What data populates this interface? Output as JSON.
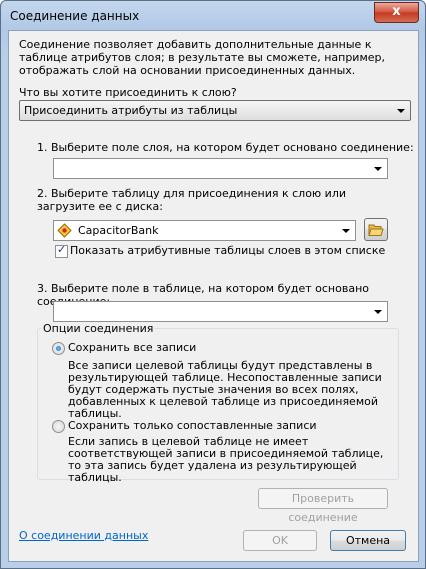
{
  "window": {
    "title": "Соединение данных",
    "close_glyph": "x"
  },
  "description": "Соединение позволяет добавить дополнительные данные к таблице атрибутов слоя; в результате вы сможете, например, отображать слой на основании присоединенных данных.",
  "question": {
    "label": "Что вы хотите присоединить к слою?",
    "value": "Присоединить атрибуты из таблицы"
  },
  "step1": {
    "label": "1.  Выберите поле слоя, на котором будет основано соединение:",
    "value": ""
  },
  "step2": {
    "label": "2.  Выберите таблицу для присоединения к слою или загрузите ее с диска:",
    "value": "CapacitorBank",
    "browse_icon": "open-folder-icon",
    "layer_icon": "table-layer-icon",
    "checkbox_label": "Показать атрибутивные таблицы слоев в этом списке",
    "checkbox_checked": true
  },
  "step3": {
    "label": "3.  Выберите поле в таблице, на котором будет основано соединение:",
    "value": ""
  },
  "options": {
    "legend": "Опции соединения",
    "keep_all": {
      "label": "Сохранить все записи",
      "selected": true,
      "description": "Все записи целевой таблицы будут представлены в результирующей таблице. Несопоставленные записи будут содержать пустые значения во всех полях, добавленных к целевой таблице из присоединяемой таблицы."
    },
    "keep_matching": {
      "label": "Сохранить только сопоставленные записи",
      "selected": false,
      "description": "Если запись в целевой таблице не имеет соответствующей записи в присоединяемой таблице, то эта запись будет удалена из результирующей таблицы."
    }
  },
  "buttons": {
    "validate": "Проверить соединение",
    "ok": "OK",
    "cancel": "Отмена"
  },
  "help_link": "О соединении данных",
  "colors": {
    "titlebar": "#b9cfe9",
    "client": "#f0f0f0",
    "link": "#0066cc",
    "close": "#c23a22"
  }
}
